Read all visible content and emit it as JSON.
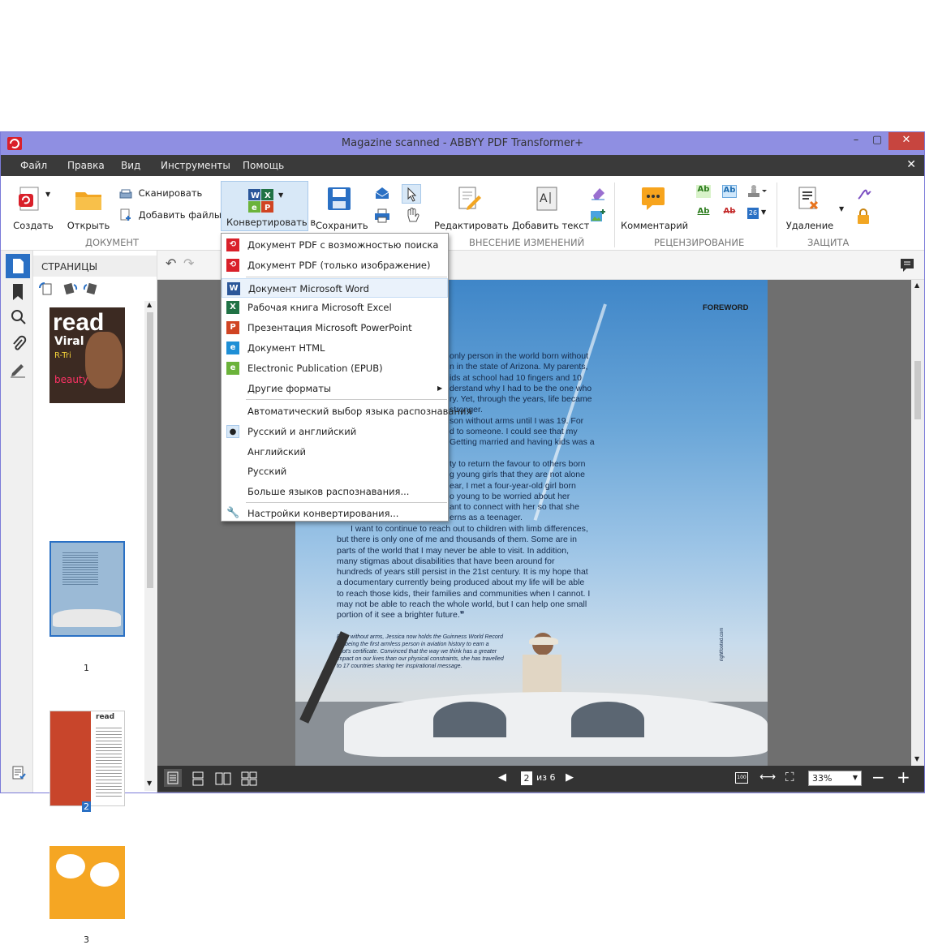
{
  "window": {
    "title": "Magazine scanned - ABBYY PDF Transformer+"
  },
  "menu": [
    "Файл",
    "Правка",
    "Вид",
    "Инструменты",
    "Помощь"
  ],
  "ribbon": {
    "create": "Создать",
    "open": "Открыть",
    "scan": "Сканировать",
    "add_files": "Добавить файлы",
    "convert_to": "Конвертировать в",
    "save": "Сохранить",
    "edit": "Редактировать",
    "add_text": "Добавить текст",
    "comment": "Комментарий",
    "delete": "Удаление",
    "group_document": "ДОКУМЕНТ",
    "group_changes": "ВНЕСЕНИЕ ИЗМЕНЕНИЙ",
    "group_review": "РЕЦЕНЗИРОВАНИЕ",
    "group_protect": "ЗАЩИТА",
    "text_icon_1": "Ab",
    "text_icon_2": "Ab",
    "text_icon_3": "Ab",
    "text_icon_4": "Ab",
    "date_icon_number": "26"
  },
  "panel": {
    "title": "СТРАНИЦЫ"
  },
  "thumbnails": [
    {
      "page": "1"
    },
    {
      "page": "2"
    },
    {
      "page": "3"
    }
  ],
  "thumbnail_text": {
    "cover_title": "read",
    "cover_line_1": "Viral",
    "cover_line_2": "R-Tri",
    "cover_line_3": "beauty",
    "page3_title": "read"
  },
  "dropdown": {
    "formats": [
      {
        "label": "Документ PDF с возможностью поиска",
        "icon": "pdf-searchable-icon",
        "color": "#d9202a",
        "glyph": "⟲"
      },
      {
        "label": "Документ PDF (только изображение)",
        "icon": "pdf-image-icon",
        "color": "#d9202a",
        "glyph": "⟲"
      },
      {
        "label": "Документ Microsoft Word",
        "icon": "word-icon",
        "color": "#2a5699",
        "glyph": "W"
      },
      {
        "label": "Рабочая книга Microsoft Excel",
        "icon": "excel-icon",
        "color": "#207245",
        "glyph": "X"
      },
      {
        "label": "Презентация Microsoft PowerPoint",
        "icon": "powerpoint-icon",
        "color": "#d04423",
        "glyph": "P"
      },
      {
        "label": "Документ HTML",
        "icon": "html-icon",
        "color": "#1e8fd6",
        "glyph": "e"
      },
      {
        "label": "Electronic Publication (EPUB)",
        "icon": "epub-icon",
        "color": "#6bb33a",
        "glyph": "e"
      },
      {
        "label": "Другие форматы",
        "icon": "",
        "color": "",
        "glyph": ""
      }
    ],
    "languages": [
      {
        "label": "Автоматический выбор языка распознавания"
      },
      {
        "label": "Русский и английский"
      },
      {
        "label": "Английский"
      },
      {
        "label": "Русский"
      },
      {
        "label": "Больше языков распознавания..."
      }
    ],
    "settings": "Настройки конвертирования..."
  },
  "document": {
    "header": "FOREWORD",
    "paragraph_right": [
      "only person in the world born without",
      "n in the state of Arizona. My parents,",
      "ids at school had 10 fingers and 10",
      "derstand why I had to be the one who",
      "ry. Yet, through the years, life became",
      "stronger.",
      "son without arms until I was 19. For",
      "d to someone. I could see that my",
      "Getting married and having kids was a"
    ],
    "paragraph_right2": [
      "ty to return the favour to others born",
      "g young girls that they are not alone",
      "ear, I met a four-year-old girl born",
      "o young to be worried about her",
      "ant to connect with her so that she",
      "erns as a teenager."
    ],
    "paragraph_main": [
      "I want to continue to reach out to children with limb differences,",
      "but there is only one of me and thousands of them. Some are in",
      "parts of the world that I may never be able to visit. In addition,",
      "many stigmas about disabilities that have been around for",
      "hundreds of years still persist in the 21st century. It is my hope that",
      "a documentary currently being produced about my life will be able",
      "to reach those kids, their families and communities when I cannot. I",
      "may not be able to reach the whole world, but I can help one small",
      "portion of it see a brighter future."
    ],
    "quote_mark": "❞",
    "caption": [
      "Born without arms, Jessica now holds the Guinness World Record",
      "for being the first armless person in aviation history to earn a",
      "pilot's certificate. Convinced that the way we think has a greater",
      "impact on our lives than our physical constraints, she has travelled",
      "to 17 countries sharing her inspirational message."
    ],
    "side_text": "rightfooted.com"
  },
  "navigation": {
    "current_page": "2",
    "of_label": "из 6",
    "zoom": "33%",
    "actual_size": "100"
  },
  "colors": {
    "titlebar": "#8f8fe2",
    "menubar": "#3a3a3a",
    "accent": "#2a70c4",
    "close": "#c7453f"
  }
}
